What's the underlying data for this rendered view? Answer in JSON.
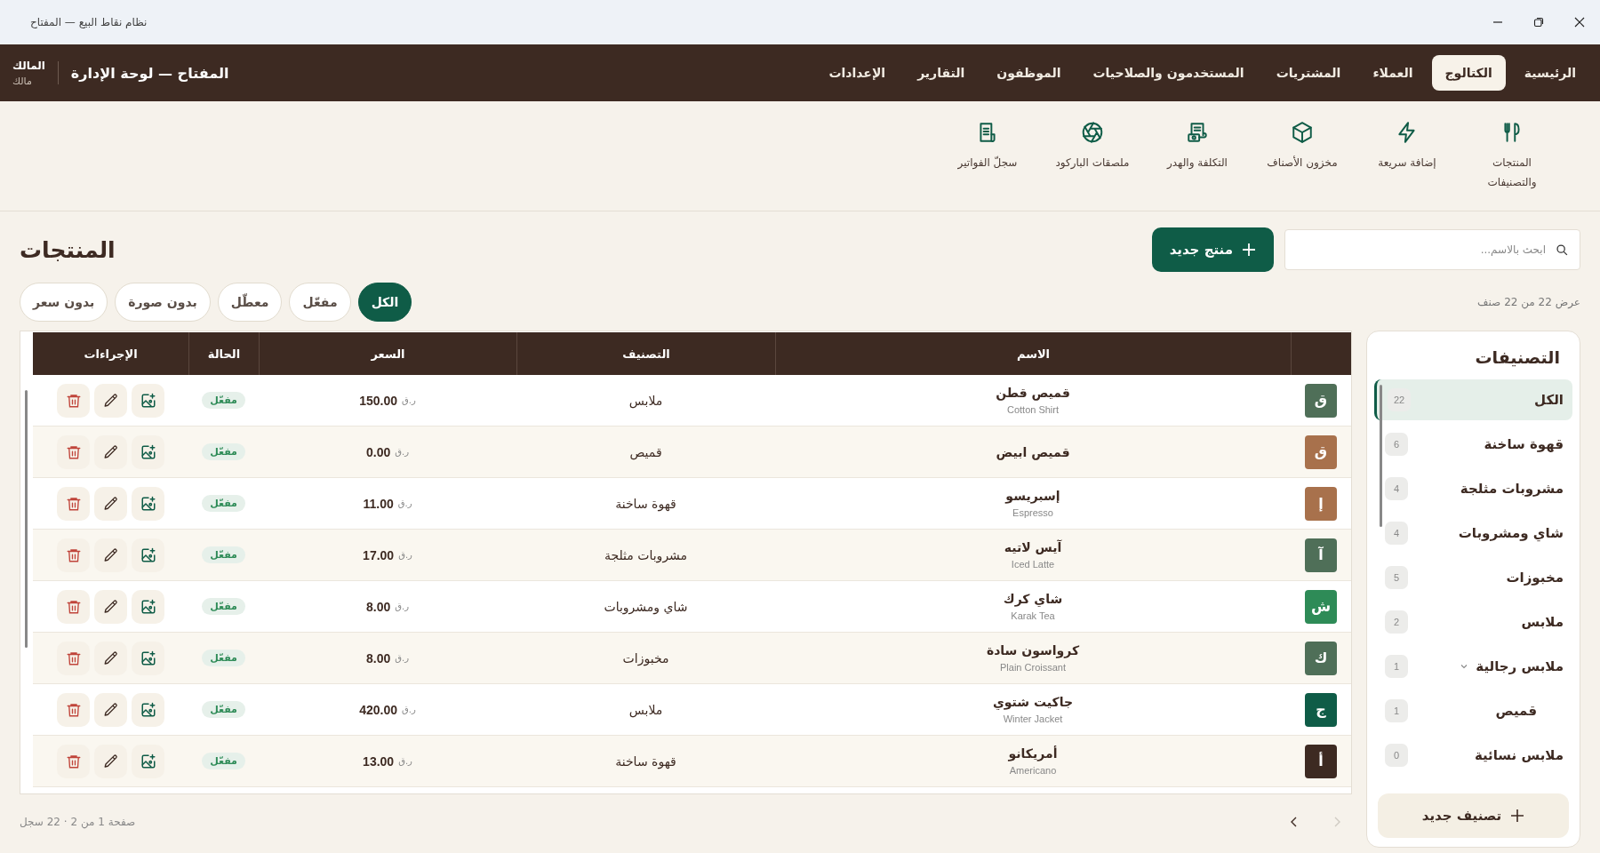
{
  "window": {
    "title": "نظام نقاط البيع — المفتاح"
  },
  "nav": {
    "tabs": [
      {
        "label": "الرئيسية",
        "selected": false
      },
      {
        "label": "الكتالوج",
        "selected": true
      },
      {
        "label": "العملاء",
        "selected": false
      },
      {
        "label": "المشتريات",
        "selected": false
      },
      {
        "label": "المستخدمون والصلاحيات",
        "selected": false
      },
      {
        "label": "الموظفون",
        "selected": false
      },
      {
        "label": "التقارير",
        "selected": false
      },
      {
        "label": "الإعدادات",
        "selected": false
      }
    ],
    "brand": "المفتاح — لوحة الإدارة",
    "user": {
      "name": "المالك",
      "role": "مالك"
    }
  },
  "subnav": [
    {
      "label": "المنتجات والتصنيفات",
      "kind": "utensils"
    },
    {
      "label": "إضافة سريعة",
      "kind": "bolt"
    },
    {
      "label": "مخزون الأصناف",
      "kind": "box"
    },
    {
      "label": "التكلفة والهدر",
      "kind": "receipt"
    },
    {
      "label": "ملصقات الباركود",
      "kind": "aperture"
    },
    {
      "label": "سجلّ الفواتير",
      "kind": "document"
    }
  ],
  "page": {
    "title": "المنتجات",
    "search": {
      "placeholder": "ابحث بالاسم..."
    },
    "new_button": "منتج جديد",
    "count": "عرض 22 من 22 صنف",
    "filters": [
      {
        "label": "الكل",
        "selected": true
      },
      {
        "label": "مفعّل",
        "selected": false
      },
      {
        "label": "معطّل",
        "selected": false
      },
      {
        "label": "بدون صورة",
        "selected": false
      },
      {
        "label": "بدون سعر",
        "selected": false
      }
    ]
  },
  "table": {
    "columns": [
      "الاسم",
      "التصنيف",
      "السعر",
      "الحالة",
      "الإجراءات"
    ],
    "rows": [
      {
        "avatar": "ق",
        "color": "#4f6f58",
        "name": "قميص قطن",
        "name_en": "Cotton Shirt",
        "category": "ملابس",
        "currency": "ر.ق",
        "price": "150.00",
        "status": "مفعّل",
        "active": true
      },
      {
        "avatar": "ق",
        "color": "#a8714c",
        "name": "قميص ابيض",
        "category": "قميص",
        "currency": "ر.ق",
        "price": "0.00",
        "status": "مفعّل",
        "active": true
      },
      {
        "avatar": "إ",
        "color": "#a8714c",
        "name": "إسبريسو",
        "name_en": "Espresso",
        "category": "قهوة ساخنة",
        "currency": "ر.ق",
        "price": "11.00",
        "status": "مفعّل",
        "active": true
      },
      {
        "avatar": "آ",
        "color": "#4f6f58",
        "name": "آيس لاتيه",
        "name_en": "Iced Latte",
        "category": "مشروبات مثلجة",
        "currency": "ر.ق",
        "price": "17.00",
        "status": "مفعّل",
        "active": true
      },
      {
        "avatar": "ش",
        "color": "#2e8b57",
        "name": "شاي كرك",
        "name_en": "Karak Tea",
        "category": "شاي ومشروبات",
        "currency": "ر.ق",
        "price": "8.00",
        "status": "مفعّل",
        "active": true
      },
      {
        "avatar": "ك",
        "color": "#4f6f58",
        "name": "كرواسون سادة",
        "name_en": "Plain Croissant",
        "category": "مخبوزات",
        "currency": "ر.ق",
        "price": "8.00",
        "status": "مفعّل",
        "active": true
      },
      {
        "avatar": "ج",
        "color": "#0f5c47",
        "name": "جاكيت شتوي",
        "name_en": "Winter Jacket",
        "category": "ملابس",
        "currency": "ر.ق",
        "price": "420.00",
        "status": "مفعّل",
        "active": true
      },
      {
        "avatar": "أ",
        "color": "#3d2a22",
        "name": "أمريكانو",
        "name_en": "Americano",
        "category": "قهوة ساخنة",
        "currency": "ر.ق",
        "price": "13.00",
        "status": "مفعّل",
        "active": true
      }
    ]
  },
  "pagination": {
    "summary": "صفحة 1 من 2 · 22 سجل",
    "prev_disabled": true,
    "next_disabled": false
  },
  "categories": {
    "title": "التصنيفات",
    "items": [
      {
        "name": "الكل",
        "count": "22",
        "selected": true
      },
      {
        "name": "قهوة ساخنة",
        "count": "6",
        "selected": false
      },
      {
        "name": "مشروبات مثلجة",
        "count": "4",
        "selected": false
      },
      {
        "name": "شاي ومشروبات",
        "count": "4",
        "selected": false
      },
      {
        "name": "مخبوزات",
        "count": "5",
        "selected": false
      },
      {
        "name": "ملابس",
        "count": "2",
        "selected": false
      },
      {
        "name": "ملابس رجالية",
        "count": "1",
        "selected": false,
        "expanded": true,
        "children": [
          {
            "name": "قميص",
            "count": "1",
            "selected": false
          }
        ]
      },
      {
        "name": "ملابس نسائية",
        "count": "0",
        "selected": false
      }
    ],
    "add_button": "تصنيف جديد"
  }
}
